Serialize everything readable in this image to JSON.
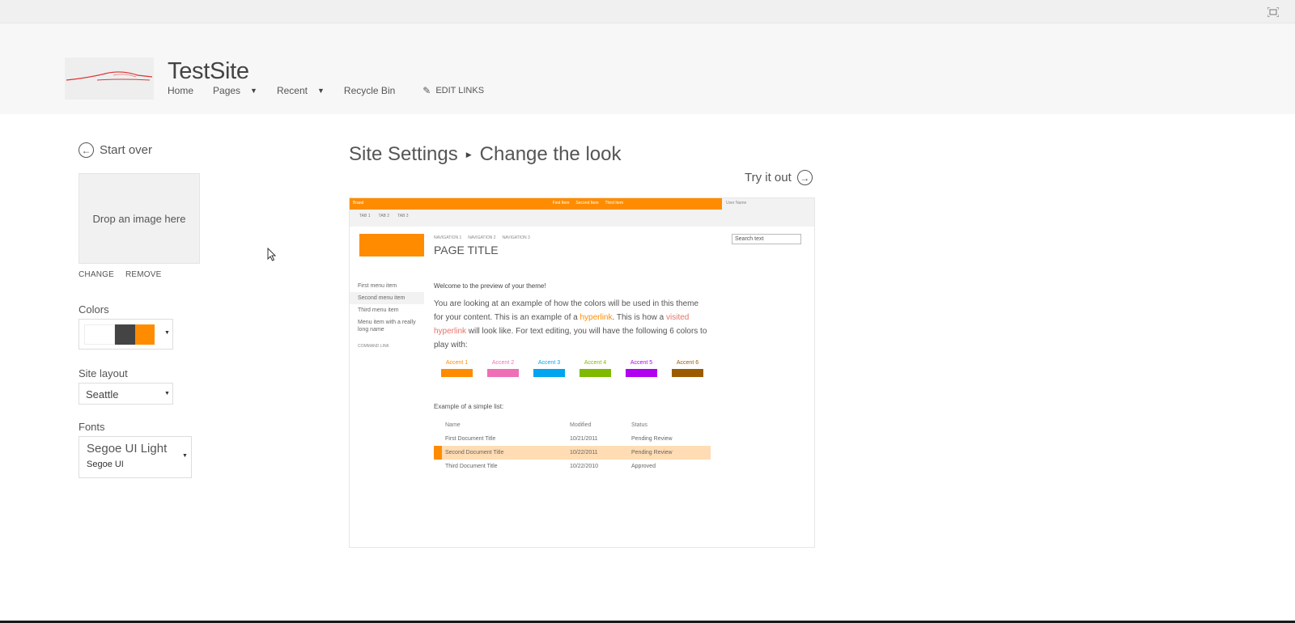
{
  "header": {
    "site_title": "TestSite",
    "nav": [
      {
        "label": "Home",
        "has_dropdown": false
      },
      {
        "label": "Pages",
        "has_dropdown": true
      },
      {
        "label": "Recent",
        "has_dropdown": true
      },
      {
        "label": "Recycle Bin",
        "has_dropdown": false
      }
    ],
    "edit_links": "EDIT LINKS"
  },
  "left_panel": {
    "start_over": "Start over",
    "drop_image": "Drop an image here",
    "change": "CHANGE",
    "remove": "REMOVE",
    "colors_label": "Colors",
    "color_swatches": [
      "#ffffff",
      "#444444",
      "#ff8c00"
    ],
    "site_layout_label": "Site layout",
    "site_layout_value": "Seattle",
    "fonts_label": "Fonts",
    "font_heading": "Segoe UI Light",
    "font_body": "Segoe UI"
  },
  "main": {
    "breadcrumb_parent": "Site Settings",
    "breadcrumb_current": "Change the look",
    "try_it_out": "Try it out"
  },
  "preview": {
    "brand": "Brand",
    "suite_links": [
      "First Item",
      "Second Item",
      "Third Item"
    ],
    "user_name": "User Name",
    "tabs": [
      "TAB 1",
      "TAB 2",
      "TAB 3"
    ],
    "navigation": [
      "NAVIGATION 1",
      "NAVIGATION 2",
      "NAVIGATION 3"
    ],
    "page_title": "PAGE TITLE",
    "search_placeholder": "Search text",
    "menu_items": [
      "First menu item",
      "Second menu item",
      "Third menu item",
      "Menu item with a really long name"
    ],
    "command_link": "COMMAND LINK",
    "welcome": "Welcome to the preview of your theme!",
    "para_1": "You are looking at an example of how the colors will be used in this theme for your content. This is an example of a ",
    "hyperlink": "hyperlink",
    "para_2": ". This is how a ",
    "visited_hyperlink": "visited hyperlink",
    "para_3": " will look like. For text editing, you will have the following 6 colors to play with:",
    "accents": [
      {
        "label": "Accent 1",
        "color": "#ff8c00"
      },
      {
        "label": "Accent 2",
        "color": "#ee6fb6"
      },
      {
        "label": "Accent 3",
        "color": "#00a4ef"
      },
      {
        "label": "Accent 4",
        "color": "#7fba00"
      },
      {
        "label": "Accent 5",
        "color": "#b100f0"
      },
      {
        "label": "Accent 6",
        "color": "#9c5b00"
      }
    ],
    "list_label": "Example of a simple list:",
    "list_headers": [
      "Name",
      "Modified",
      "Status"
    ],
    "list_rows": [
      [
        "First Document Title",
        "10/21/2011",
        "Pending Review"
      ],
      [
        "Second Document Title",
        "10/22/2011",
        "Pending Review"
      ],
      [
        "Third Document Title",
        "10/22/2010",
        "Approved"
      ]
    ],
    "highlight_row": 1
  }
}
